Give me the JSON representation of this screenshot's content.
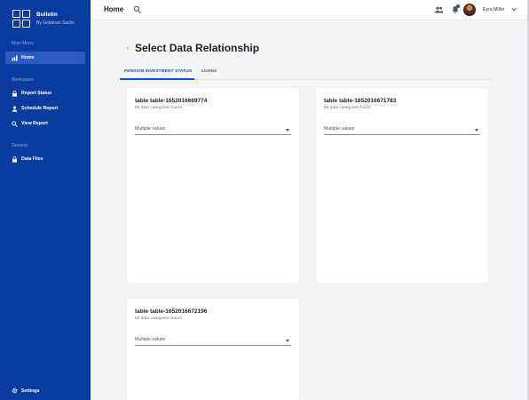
{
  "brand": {
    "title": "Bulletin",
    "subtitle": "By Goldman Sachs"
  },
  "sidebar": {
    "main_menu_label": "Main Menu",
    "home_label": "Home",
    "workspace_label": "Workspace",
    "workspace_items": [
      {
        "label": "Report Status",
        "icon": "lock-icon"
      },
      {
        "label": "Schedule Report",
        "icon": "person-icon"
      },
      {
        "label": "View Report",
        "icon": "search-icon"
      }
    ],
    "general_label": "General",
    "data_files_label": "Data Files",
    "settings_label": "Settings"
  },
  "header": {
    "title": "Home",
    "user_name": "Ezra Miller"
  },
  "main": {
    "title": "Select Data Relationship",
    "tabs": [
      {
        "label": "PENSION INVESTMENT STATUS",
        "active": true
      },
      {
        "label": "LOANS",
        "active": false
      }
    ],
    "cards": [
      {
        "title": "table table-1652016669774",
        "subtitle": "55 data categories found",
        "select_value": "Multiple values"
      },
      {
        "title": "table table-1652016671783",
        "subtitle": "55 data categories found",
        "select_value": "Multiple values"
      },
      {
        "title": "table table-1652016672196",
        "subtitle": "55 data categories found",
        "select_value": "Multiple values"
      }
    ]
  },
  "colors": {
    "sidebar": "#0a3b9e",
    "accent": "#1a4fc0",
    "active_nav": "#2d5bc4"
  }
}
